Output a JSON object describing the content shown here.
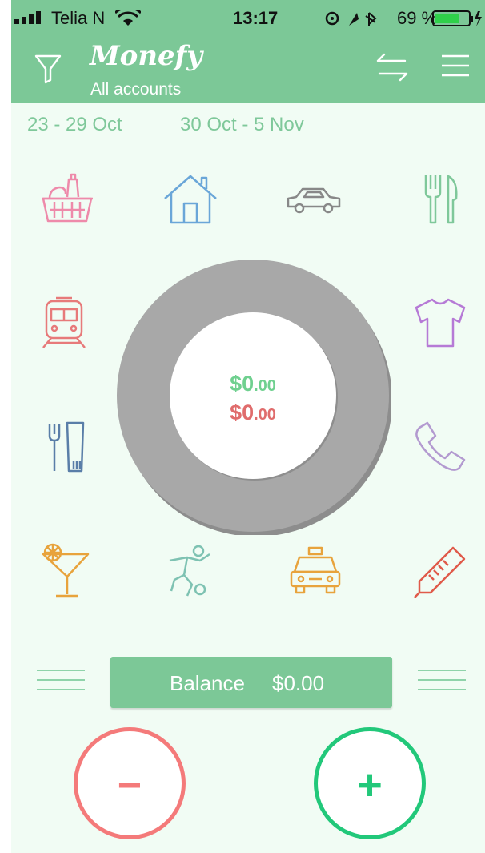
{
  "status_bar": {
    "carrier": "Telia N",
    "time": "13:17",
    "battery": "69 %"
  },
  "header": {
    "title": "Monefy",
    "subtitle": "All accounts",
    "icons": [
      "filter-icon",
      "transfer-icon",
      "menu-icon"
    ]
  },
  "periods": {
    "previous": "23 - 29 Oct",
    "current": "30 Oct - 5 Nov"
  },
  "categories": [
    {
      "name": "groceries-icon",
      "color": "#ee8aaa"
    },
    {
      "name": "house-icon",
      "color": "#6aa6d8"
    },
    {
      "name": "car-icon",
      "color": "#888888"
    },
    {
      "name": "eating-out-icon",
      "color": "#7fc89a"
    },
    {
      "name": "transport-icon",
      "color": "#e77a7a"
    },
    {
      "name": "clothes-icon",
      "color": "#b67ad6"
    },
    {
      "name": "toiletry-icon",
      "color": "#5a7ea8"
    },
    {
      "name": "phone-icon",
      "color": "#b39ad0"
    },
    {
      "name": "entertainment-icon",
      "color": "#e8a33c"
    },
    {
      "name": "sports-icon",
      "color": "#7ec2b2"
    },
    {
      "name": "taxi-icon",
      "color": "#e8a33c"
    },
    {
      "name": "health-icon",
      "color": "#e05a4a"
    }
  ],
  "summary": {
    "income_main": "$0",
    "income_cents": ".00",
    "expense_main": "$0",
    "expense_cents": ".00",
    "income_color": "#6fd08f",
    "expense_color": "#e06c6c"
  },
  "balance": {
    "label": "Balance",
    "value": "$0.00"
  },
  "actions": {
    "minus": "−",
    "plus": "+",
    "minus_color": "#f47a7a",
    "plus_color": "#22c87a"
  }
}
